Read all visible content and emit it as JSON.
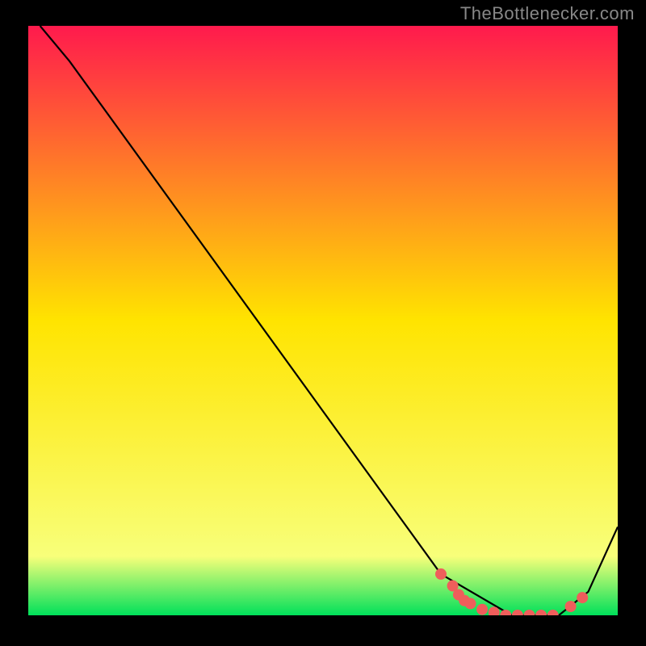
{
  "watermark": "TheBottlenecker.com",
  "chart_data": {
    "type": "line",
    "title": "",
    "xlabel": "",
    "ylabel": "",
    "xlim": [
      0,
      100
    ],
    "ylim": [
      0,
      100
    ],
    "background": {
      "stops": [
        {
          "offset": 0,
          "color": "#ff1a4d"
        },
        {
          "offset": 50,
          "color": "#ffe400"
        },
        {
          "offset": 90,
          "color": "#f8ff7a"
        },
        {
          "offset": 100,
          "color": "#00e05a"
        }
      ]
    },
    "series": [
      {
        "name": "bottleneck-curve",
        "color": "#000000",
        "x": [
          2,
          7,
          70,
          82,
          90,
          95,
          100
        ],
        "y": [
          100,
          94,
          7,
          0,
          0,
          4,
          15
        ]
      }
    ],
    "markers": [
      {
        "name": "highlight-points",
        "color": "#ef5e5b",
        "points": [
          {
            "x": 70,
            "y": 7
          },
          {
            "x": 72,
            "y": 5
          },
          {
            "x": 73,
            "y": 3.5
          },
          {
            "x": 74,
            "y": 2.5
          },
          {
            "x": 75,
            "y": 2
          },
          {
            "x": 77,
            "y": 1
          },
          {
            "x": 79,
            "y": 0.5
          },
          {
            "x": 81,
            "y": 0
          },
          {
            "x": 83,
            "y": 0
          },
          {
            "x": 85,
            "y": 0
          },
          {
            "x": 87,
            "y": 0
          },
          {
            "x": 89,
            "y": 0
          },
          {
            "x": 92,
            "y": 1.5
          },
          {
            "x": 94,
            "y": 3
          }
        ]
      }
    ]
  }
}
